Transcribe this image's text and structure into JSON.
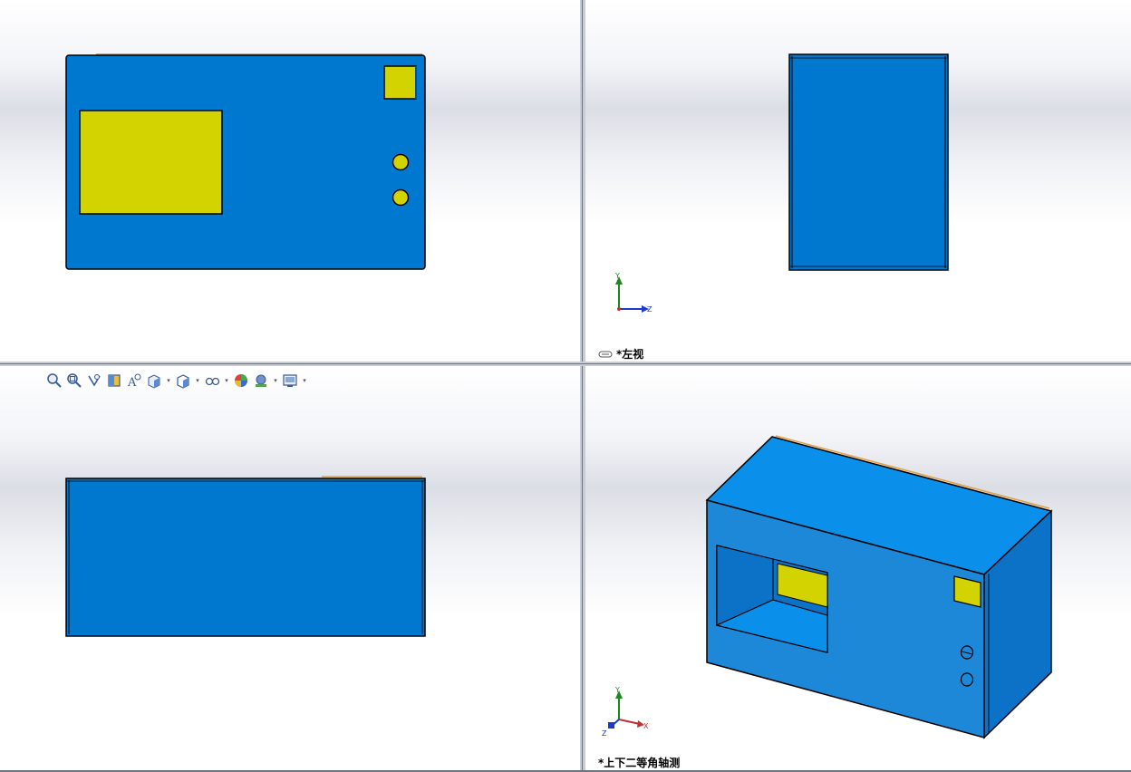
{
  "viewports": {
    "front": {},
    "left": {
      "label": "*左视"
    },
    "top": {},
    "isometric": {
      "label": "*上下二等角轴测"
    }
  },
  "triad": {
    "x": "X",
    "y": "Y",
    "z": "Z"
  },
  "heads_up_toolbar": [
    "zoom-to-fit-icon",
    "zoom-to-area-icon",
    "previous-view-icon",
    "section-view-icon",
    "dynamic-annotation-icon",
    "view-orientation-icon",
    "display-style-icon",
    "hide-show-items-icon",
    "edit-appearance-icon",
    "apply-scene-icon",
    "view-settings-icon"
  ],
  "colors": {
    "body_blue": "#0078cf",
    "iso_front": "#1e88d8",
    "iso_top": "#0a90ea",
    "iso_side": "#0b72c8",
    "accent_yellow": "#d2d300"
  }
}
